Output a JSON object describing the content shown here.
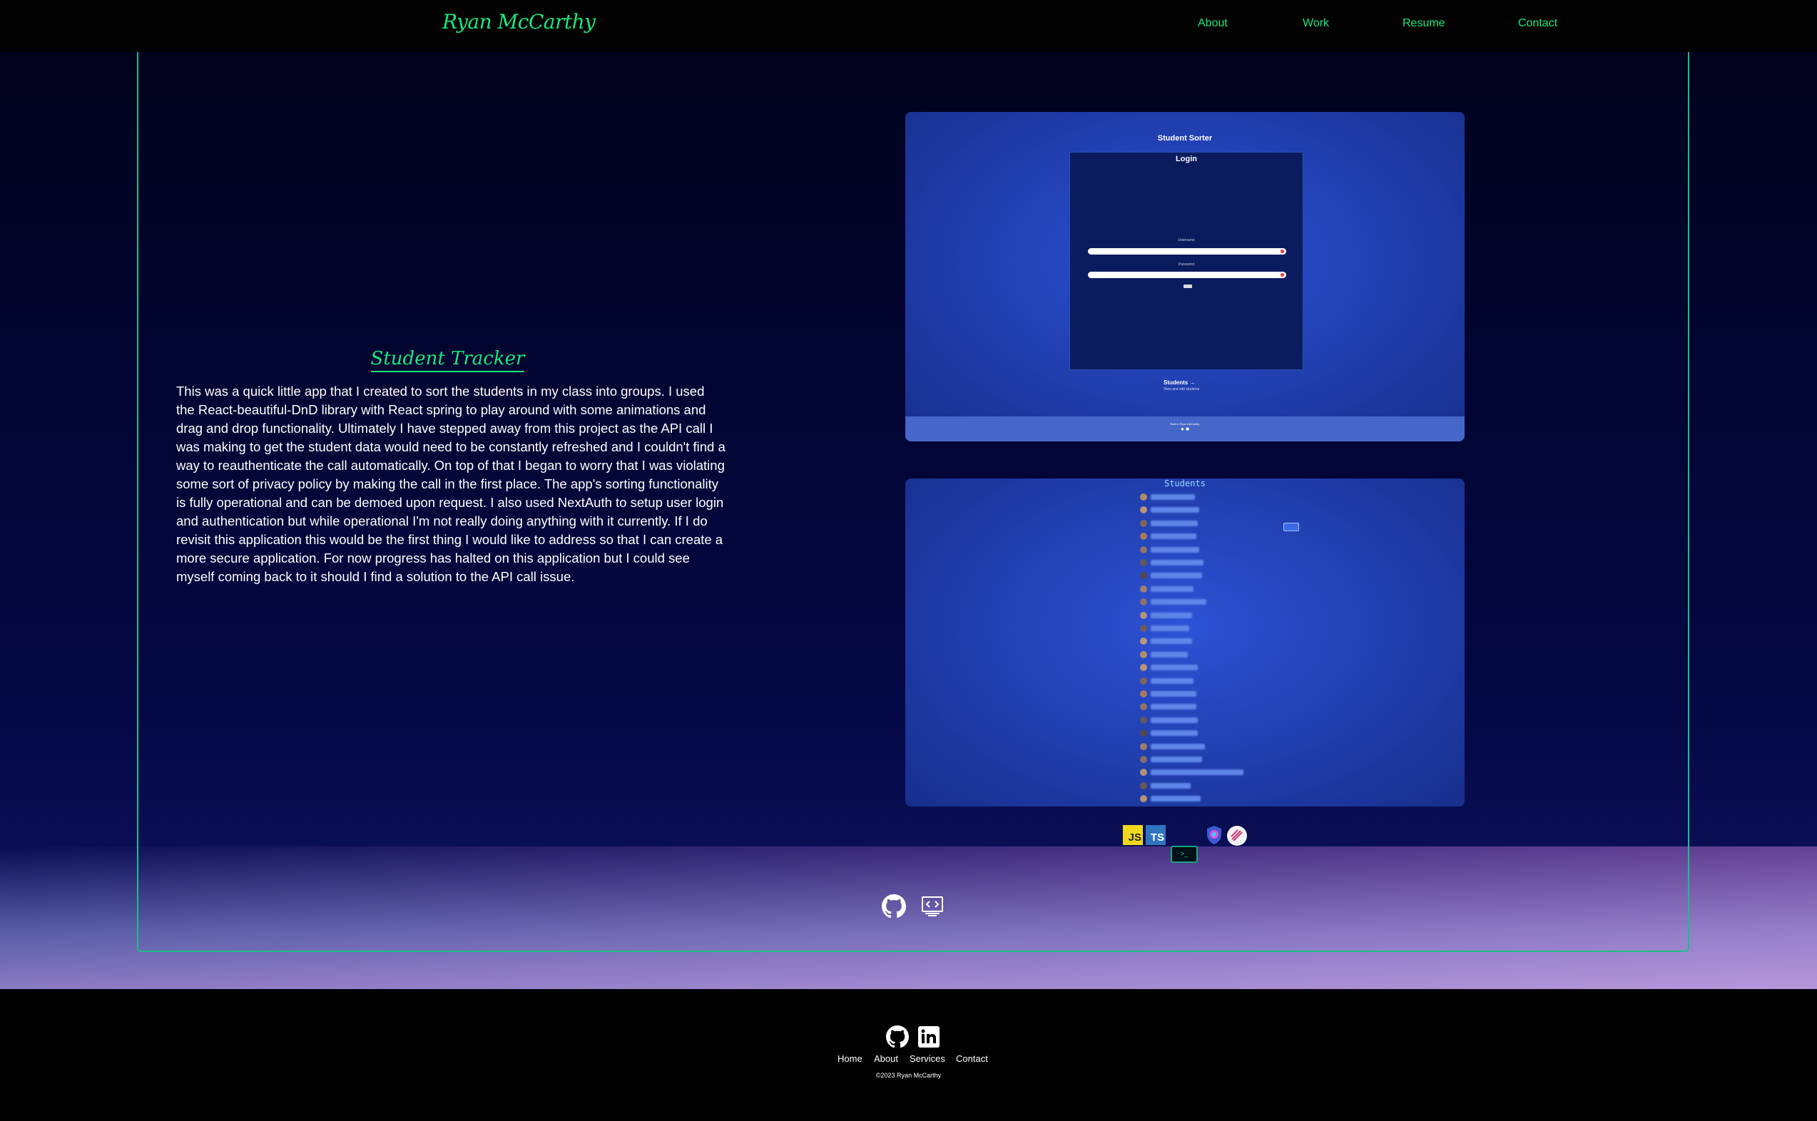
{
  "header": {
    "brand": "Ryan McCarthy",
    "nav": [
      "About",
      "Work",
      "Resume",
      "Contact"
    ]
  },
  "project": {
    "title": "Student Tracker",
    "description": "This was a quick little app that I created to sort the students in my class into groups. I used the React-beautiful-DnD library with React spring to play around with some animations and drag and drop functionality. Ultimately I have stepped away from this project as the API call I was making to get the student data would need to be constantly refreshed and I couldn't find a way to reauthenticate the call automatically. On top of that I began to worry that I was violating some sort of privacy policy by making the call in the first place. The app's sorting functionality is fully operational and can be demoed upon request. I also used NextAuth to setup user login and authentication but while operational I'm not really doing anything with it currently. If I do revisit this application this would be the first thing I would like to address so that I can create a more secure application. For now progress has halted on this application but I could see myself coming back to it should I find a solution to the API call issue.",
    "screenshot_login": {
      "app_title": "Student Sorter",
      "login_title": "Login",
      "username_label": "Username",
      "password_label": "Password",
      "button_label": "Sign",
      "students_link": "Students →",
      "students_sub": "View and edit students",
      "footer_text": "Built in Ryan McCarthy"
    },
    "screenshot_list": {
      "title": "Students"
    },
    "tech_icons": [
      "javascript-icon",
      "typescript-icon",
      "nextjs-icon",
      "nextauth-icon",
      "react-spring-icon"
    ],
    "links": [
      "github-icon",
      "live-demo-icon"
    ]
  },
  "footer": {
    "links": [
      "Home",
      "About",
      "Services",
      "Contact"
    ],
    "copyright": "©2023 Ryan McCarthy"
  },
  "colors": {
    "accent": "#19e87c",
    "card_border": "#1bbf86",
    "screenshot_blue": "#2343b8"
  }
}
